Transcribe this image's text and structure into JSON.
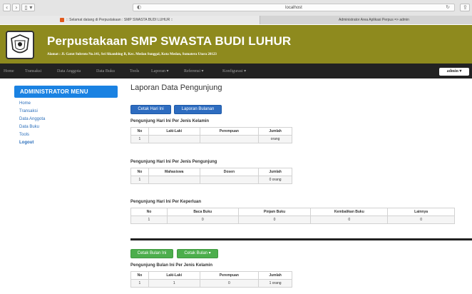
{
  "browser": {
    "url": "localhost",
    "tabs": [
      {
        "title": ":: Selamat datang di Perpustakaan : SMP SWASTA BUDI LUHUR ::"
      },
      {
        "title": "Administrator Area Aplikasi Perpus => admin"
      }
    ]
  },
  "header": {
    "title": "Perpustakaan SMP SWASTA BUDI LUHUR",
    "address": "Alamat : Jl. Gatot Subroto No.141, Sei Sikambing B, Kec. Medan Sunggal, Kota Medan, Sumatera Utara 20123"
  },
  "nav": {
    "items": [
      "Home",
      "Transaksi",
      "Data Anggota",
      "Data Buku",
      "Tools",
      "Laporan ▾",
      "Referensi ▾",
      "Konfigurasi ▾"
    ],
    "user": "admin ▾"
  },
  "sidebar": {
    "heading": "ADMINISTRATOR MENU",
    "items": [
      "Home",
      "Transaksi",
      "Data Anggota",
      "Data Buku",
      "Tools",
      "Logout"
    ]
  },
  "main": {
    "title": "Laporan Data Pengunjung",
    "buttons": {
      "cetak_hari_ini": "Cetak Hari Ini",
      "laporan_bulanan": "Laporan Bulanan",
      "cetak_bulan_ini": "Cetak Bulan Ini",
      "cetak_bulan": "Cetak Bulan ▾"
    },
    "section1": {
      "title": "Pengunjung Hari Ini Per Jenis Kelamin",
      "headers": [
        "No",
        "Laki-Laki",
        "Perempuan",
        "Jumlah"
      ],
      "row": [
        "1",
        "",
        "",
        "orang"
      ]
    },
    "section2": {
      "title": "Pengunjung Hari Ini Per Jenis Pengunjung",
      "headers": [
        "No",
        "Mahasiswa",
        "Dosen",
        "Jumlah"
      ],
      "row": [
        "1",
        "",
        "",
        "0 orang"
      ]
    },
    "section3": {
      "title": "Pengunjung Hari Ini Per Keperluan",
      "headers": [
        "No",
        "Baca Buku",
        "Pinjam Buku",
        "Kembalikan Buku",
        "Lainnya"
      ],
      "row": [
        "1",
        "0",
        "0",
        "0",
        "0"
      ]
    },
    "section4": {
      "title": "Pengunjung Bulan Ini Per Jenis Kelamin",
      "headers": [
        "No",
        "Laki-Laki",
        "Perempuan",
        "Jumlah"
      ],
      "row": [
        "1",
        "1",
        "0",
        "1 orang"
      ]
    }
  }
}
